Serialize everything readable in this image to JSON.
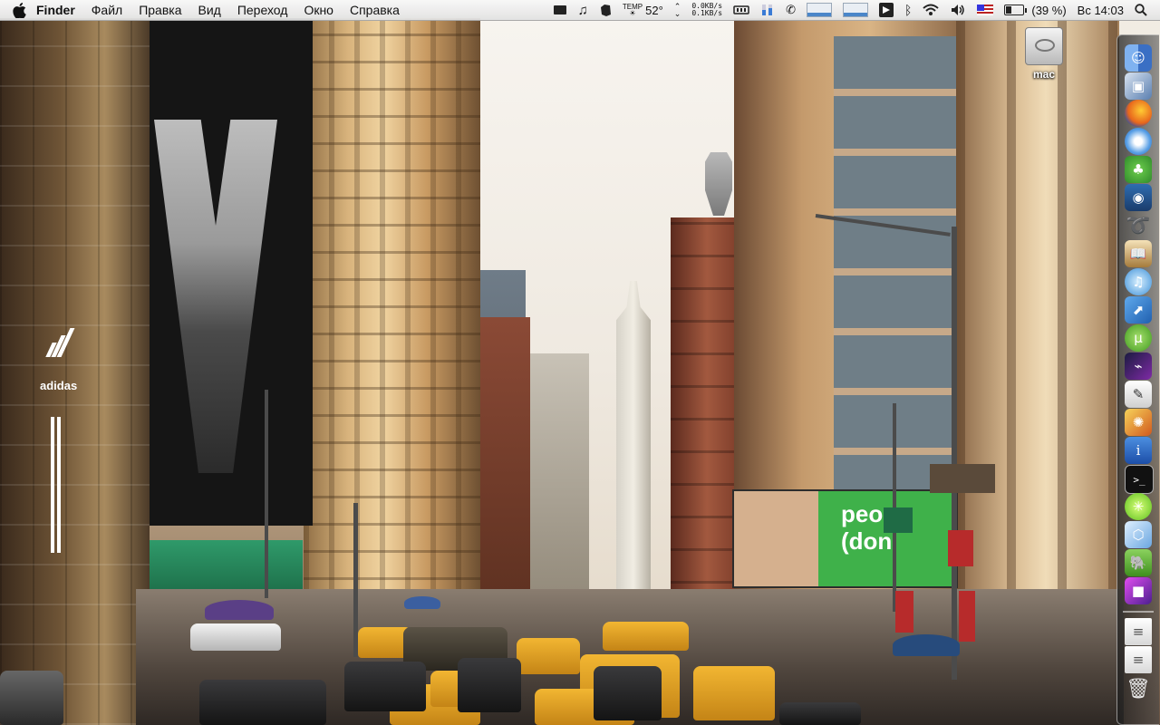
{
  "menubar": {
    "app_name": "Finder",
    "menus": [
      "Файл",
      "Правка",
      "Вид",
      "Переход",
      "Окно",
      "Справка"
    ],
    "status": {
      "temperature": "52°",
      "net_down": "0.0KB/s",
      "net_up": "0.1KB/s",
      "battery_percent": "(39 %)",
      "clock": "Вс 14:03"
    }
  },
  "desktop": {
    "volume_label": "mac"
  },
  "wallpaper": {
    "billboard_text_1": "peo",
    "billboard_text_2": "(don",
    "storefront_brand": "adidas"
  },
  "dock": {
    "items": [
      "finder-icon",
      "preview-icon",
      "firefox-icon",
      "safari-icon",
      "adium-icon",
      "photo-booth-icon",
      "acrobat-icon",
      "dictionary-icon",
      "itunes-icon",
      "launchpad-icon",
      "utorrent-icon",
      "transmit-icon",
      "textedit-icon",
      "iphoto-icon",
      "system-info-icon",
      "terminal-icon",
      "lime-icon",
      "box-icon",
      "evernote-icon",
      "purple-app-icon",
      "document-1-icon",
      "document-2-icon",
      "trash-icon"
    ]
  }
}
